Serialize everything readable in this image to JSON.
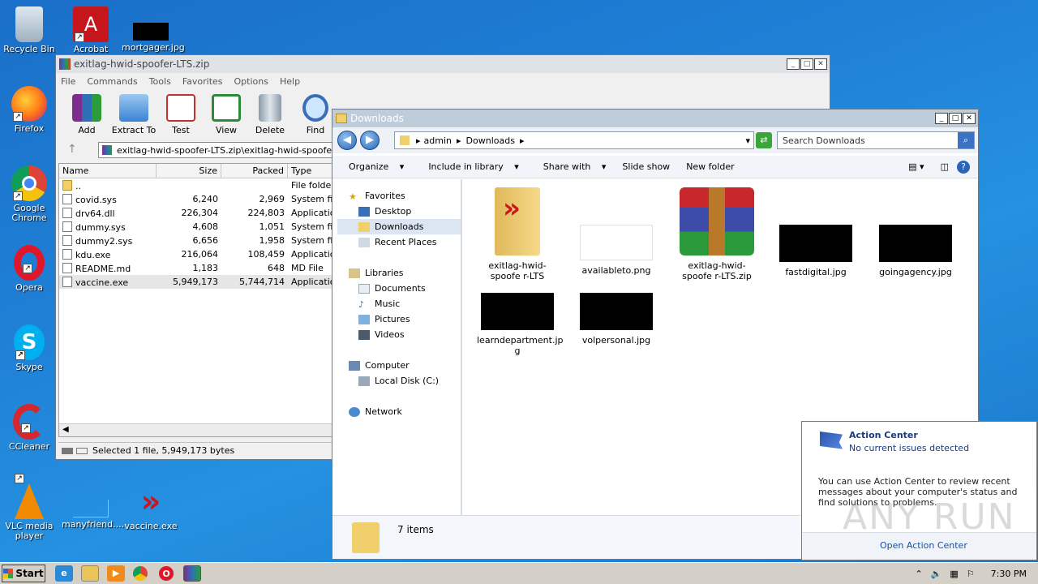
{
  "desktop": {
    "icons": [
      {
        "label": "Recycle Bin"
      },
      {
        "label": "Acrobat"
      },
      {
        "label": "mortgager.jpg"
      },
      {
        "label": "Firefox"
      },
      {
        "label": "Google Chrome"
      },
      {
        "label": "Opera"
      },
      {
        "label": "Skype"
      },
      {
        "label": "CCleaner"
      },
      {
        "label": "VLC media player"
      },
      {
        "label": "manyfriend...."
      },
      {
        "label": "vaccine.exe"
      }
    ]
  },
  "winrar": {
    "title": "exitlag-hwid-spoofer-LTS.zip",
    "menu": [
      "File",
      "Commands",
      "Tools",
      "Favorites",
      "Options",
      "Help"
    ],
    "toolbar": [
      "Add",
      "Extract To",
      "Test",
      "View",
      "Delete",
      "Find"
    ],
    "path": "exitlag-hwid-spoofer-LTS.zip\\exitlag-hwid-spoofer-LTS",
    "columns": [
      "Name",
      "Size",
      "Packed",
      "Type"
    ],
    "rows": [
      {
        "name": "..",
        "size": "",
        "packed": "",
        "type": "File folder"
      },
      {
        "name": "covid.sys",
        "size": "6,240",
        "packed": "2,969",
        "type": "System file"
      },
      {
        "name": "drv64.dll",
        "size": "226,304",
        "packed": "224,803",
        "type": "Application"
      },
      {
        "name": "dummy.sys",
        "size": "4,608",
        "packed": "1,051",
        "type": "System file"
      },
      {
        "name": "dummy2.sys",
        "size": "6,656",
        "packed": "1,958",
        "type": "System file"
      },
      {
        "name": "kdu.exe",
        "size": "216,064",
        "packed": "108,459",
        "type": "Application"
      },
      {
        "name": "README.md",
        "size": "1,183",
        "packed": "648",
        "type": "MD File"
      },
      {
        "name": "vaccine.exe",
        "size": "5,949,173",
        "packed": "5,744,714",
        "type": "Application"
      }
    ],
    "status": "Selected 1 file, 5,949,173 bytes"
  },
  "explorer": {
    "title": "Downloads",
    "breadcrumb": [
      "admin",
      "Downloads"
    ],
    "search_placeholder": "Search Downloads",
    "commands": [
      "Organize",
      "Include in library",
      "Share with",
      "Slide show",
      "New folder"
    ],
    "nav": {
      "favorites": "Favorites",
      "desktop": "Desktop",
      "downloads": "Downloads",
      "recent": "Recent Places",
      "libraries": "Libraries",
      "documents": "Documents",
      "music": "Music",
      "pictures": "Pictures",
      "videos": "Videos",
      "computer": "Computer",
      "localdisk": "Local Disk (C:)",
      "network": "Network"
    },
    "files": [
      {
        "name": "exitlag-hwid-spoofe r-LTS"
      },
      {
        "name": "availableto.png"
      },
      {
        "name": "exitlag-hwid-spoofe r-LTS.zip"
      },
      {
        "name": "fastdigital.jpg"
      },
      {
        "name": "goingagency.jpg"
      },
      {
        "name": "learndepartment.jp g"
      },
      {
        "name": "volpersonal.jpg"
      }
    ],
    "item_count": "7 items"
  },
  "action_center": {
    "title": "Action Center",
    "subtitle": "No current issues detected",
    "body": "You can use Action Center to review recent messages about your computer's status and find solutions to problems.",
    "link": "Open Action Center"
  },
  "taskbar": {
    "start": "Start",
    "clock": "7:30 PM"
  },
  "watermark": "ANY RUN"
}
